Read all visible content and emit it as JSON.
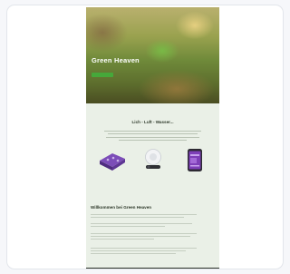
{
  "hero": {
    "title": "Green Heaven",
    "cta": "",
    "nav": [
      "",
      "",
      "",
      ""
    ]
  },
  "tagline": {
    "title": "Lich - Luft - Wasser...",
    "subtitle": ""
  },
  "products": [
    {
      "caption": "",
      "icon": "grow-tray-icon",
      "color": "#6b3fa3"
    },
    {
      "caption": "",
      "icon": "sensor-icon",
      "color": "#d9dce0"
    },
    {
      "caption": "",
      "icon": "smartphone-app-icon",
      "color": "#6b3fa3"
    }
  ],
  "welcome": {
    "label": "",
    "title": "Willkommen bei Green Heaven"
  },
  "colors": {
    "accent": "#46a83a",
    "page_background": "#eaf0e7",
    "footer": "#2b3128"
  },
  "footer": {
    "text": ""
  }
}
